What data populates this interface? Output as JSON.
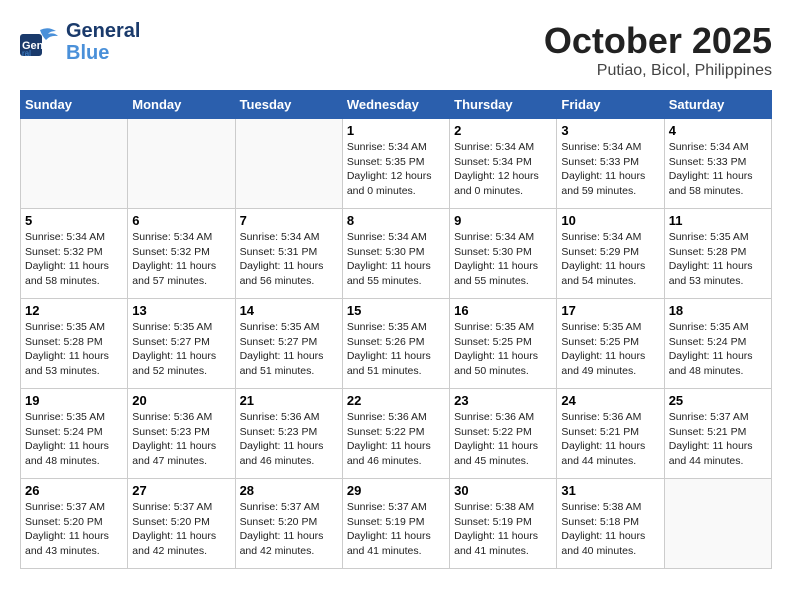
{
  "header": {
    "logo_line1": "General",
    "logo_line2": "Blue",
    "month_title": "October 2025",
    "location": "Putiao, Bicol, Philippines"
  },
  "weekdays": [
    "Sunday",
    "Monday",
    "Tuesday",
    "Wednesday",
    "Thursday",
    "Friday",
    "Saturday"
  ],
  "weeks": [
    [
      {
        "day": "",
        "info": ""
      },
      {
        "day": "",
        "info": ""
      },
      {
        "day": "",
        "info": ""
      },
      {
        "day": "1",
        "info": "Sunrise: 5:34 AM\nSunset: 5:35 PM\nDaylight: 12 hours\nand 0 minutes."
      },
      {
        "day": "2",
        "info": "Sunrise: 5:34 AM\nSunset: 5:34 PM\nDaylight: 12 hours\nand 0 minutes."
      },
      {
        "day": "3",
        "info": "Sunrise: 5:34 AM\nSunset: 5:33 PM\nDaylight: 11 hours\nand 59 minutes."
      },
      {
        "day": "4",
        "info": "Sunrise: 5:34 AM\nSunset: 5:33 PM\nDaylight: 11 hours\nand 58 minutes."
      }
    ],
    [
      {
        "day": "5",
        "info": "Sunrise: 5:34 AM\nSunset: 5:32 PM\nDaylight: 11 hours\nand 58 minutes."
      },
      {
        "day": "6",
        "info": "Sunrise: 5:34 AM\nSunset: 5:32 PM\nDaylight: 11 hours\nand 57 minutes."
      },
      {
        "day": "7",
        "info": "Sunrise: 5:34 AM\nSunset: 5:31 PM\nDaylight: 11 hours\nand 56 minutes."
      },
      {
        "day": "8",
        "info": "Sunrise: 5:34 AM\nSunset: 5:30 PM\nDaylight: 11 hours\nand 55 minutes."
      },
      {
        "day": "9",
        "info": "Sunrise: 5:34 AM\nSunset: 5:30 PM\nDaylight: 11 hours\nand 55 minutes."
      },
      {
        "day": "10",
        "info": "Sunrise: 5:34 AM\nSunset: 5:29 PM\nDaylight: 11 hours\nand 54 minutes."
      },
      {
        "day": "11",
        "info": "Sunrise: 5:35 AM\nSunset: 5:28 PM\nDaylight: 11 hours\nand 53 minutes."
      }
    ],
    [
      {
        "day": "12",
        "info": "Sunrise: 5:35 AM\nSunset: 5:28 PM\nDaylight: 11 hours\nand 53 minutes."
      },
      {
        "day": "13",
        "info": "Sunrise: 5:35 AM\nSunset: 5:27 PM\nDaylight: 11 hours\nand 52 minutes."
      },
      {
        "day": "14",
        "info": "Sunrise: 5:35 AM\nSunset: 5:27 PM\nDaylight: 11 hours\nand 51 minutes."
      },
      {
        "day": "15",
        "info": "Sunrise: 5:35 AM\nSunset: 5:26 PM\nDaylight: 11 hours\nand 51 minutes."
      },
      {
        "day": "16",
        "info": "Sunrise: 5:35 AM\nSunset: 5:25 PM\nDaylight: 11 hours\nand 50 minutes."
      },
      {
        "day": "17",
        "info": "Sunrise: 5:35 AM\nSunset: 5:25 PM\nDaylight: 11 hours\nand 49 minutes."
      },
      {
        "day": "18",
        "info": "Sunrise: 5:35 AM\nSunset: 5:24 PM\nDaylight: 11 hours\nand 48 minutes."
      }
    ],
    [
      {
        "day": "19",
        "info": "Sunrise: 5:35 AM\nSunset: 5:24 PM\nDaylight: 11 hours\nand 48 minutes."
      },
      {
        "day": "20",
        "info": "Sunrise: 5:36 AM\nSunset: 5:23 PM\nDaylight: 11 hours\nand 47 minutes."
      },
      {
        "day": "21",
        "info": "Sunrise: 5:36 AM\nSunset: 5:23 PM\nDaylight: 11 hours\nand 46 minutes."
      },
      {
        "day": "22",
        "info": "Sunrise: 5:36 AM\nSunset: 5:22 PM\nDaylight: 11 hours\nand 46 minutes."
      },
      {
        "day": "23",
        "info": "Sunrise: 5:36 AM\nSunset: 5:22 PM\nDaylight: 11 hours\nand 45 minutes."
      },
      {
        "day": "24",
        "info": "Sunrise: 5:36 AM\nSunset: 5:21 PM\nDaylight: 11 hours\nand 44 minutes."
      },
      {
        "day": "25",
        "info": "Sunrise: 5:37 AM\nSunset: 5:21 PM\nDaylight: 11 hours\nand 44 minutes."
      }
    ],
    [
      {
        "day": "26",
        "info": "Sunrise: 5:37 AM\nSunset: 5:20 PM\nDaylight: 11 hours\nand 43 minutes."
      },
      {
        "day": "27",
        "info": "Sunrise: 5:37 AM\nSunset: 5:20 PM\nDaylight: 11 hours\nand 42 minutes."
      },
      {
        "day": "28",
        "info": "Sunrise: 5:37 AM\nSunset: 5:20 PM\nDaylight: 11 hours\nand 42 minutes."
      },
      {
        "day": "29",
        "info": "Sunrise: 5:37 AM\nSunset: 5:19 PM\nDaylight: 11 hours\nand 41 minutes."
      },
      {
        "day": "30",
        "info": "Sunrise: 5:38 AM\nSunset: 5:19 PM\nDaylight: 11 hours\nand 41 minutes."
      },
      {
        "day": "31",
        "info": "Sunrise: 5:38 AM\nSunset: 5:18 PM\nDaylight: 11 hours\nand 40 minutes."
      },
      {
        "day": "",
        "info": ""
      }
    ]
  ]
}
